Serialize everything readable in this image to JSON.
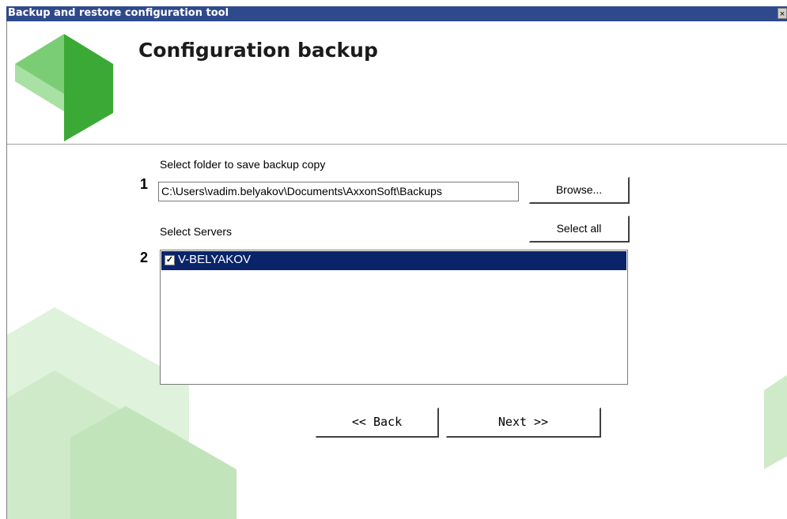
{
  "window": {
    "title": "Backup and restore configuration tool",
    "close_glyph": "×"
  },
  "header": {
    "title": "Configuration backup",
    "logo_icon": "green-cube-logo-icon"
  },
  "step1": {
    "number": "1",
    "label": "Select folder to save backup copy",
    "path_value": "C:\\Users\\vadim.belyakov\\Documents\\AxxonSoft\\Backups",
    "browse_label": "Browse..."
  },
  "step2": {
    "number": "2",
    "label": "Select Servers",
    "select_all_label": "Select all",
    "servers": [
      {
        "name": "V-BELYAKOV",
        "checked": true,
        "selected": true
      }
    ]
  },
  "nav": {
    "back_label": "<< Back",
    "next_label": "Next >>"
  },
  "colors": {
    "title_bar": "#2e4a8c",
    "selection": "#0a246a",
    "logo_green_dark": "#3aa935",
    "logo_green_light": "#8fd58a",
    "bg_green": "#d4edcf"
  }
}
